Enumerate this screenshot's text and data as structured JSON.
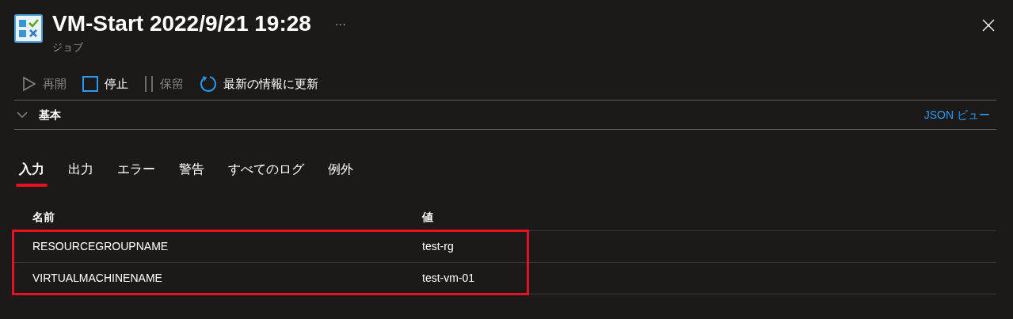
{
  "header": {
    "title": "VM-Start 2022/9/21 19:28",
    "more": "···",
    "subtitle": "ジョブ"
  },
  "toolbar": [
    {
      "kind": "play",
      "label": "再開",
      "disabled": true
    },
    {
      "kind": "stop",
      "label": "停止",
      "disabled": false
    },
    {
      "kind": "pause",
      "label": "保留",
      "disabled": true
    },
    {
      "kind": "refresh",
      "label": "最新の情報に更新",
      "disabled": false
    }
  ],
  "section": {
    "title": "基本",
    "expanded": false,
    "link": "JSON ビュー"
  },
  "tabs": [
    {
      "label": "入力",
      "selected": true
    },
    {
      "label": "出力",
      "selected": false
    },
    {
      "label": "エラー",
      "selected": false
    },
    {
      "label": "警告",
      "selected": false
    },
    {
      "label": "すべてのログ",
      "selected": false
    },
    {
      "label": "例外",
      "selected": false
    }
  ],
  "table": {
    "columns": [
      "名前",
      "値"
    ],
    "highlighted": true,
    "rows": [
      [
        "RESOURCEGROUPNAME",
        "test-rg"
      ],
      [
        "VIRTUALMACHINENAME",
        "test-vm-01"
      ]
    ]
  }
}
